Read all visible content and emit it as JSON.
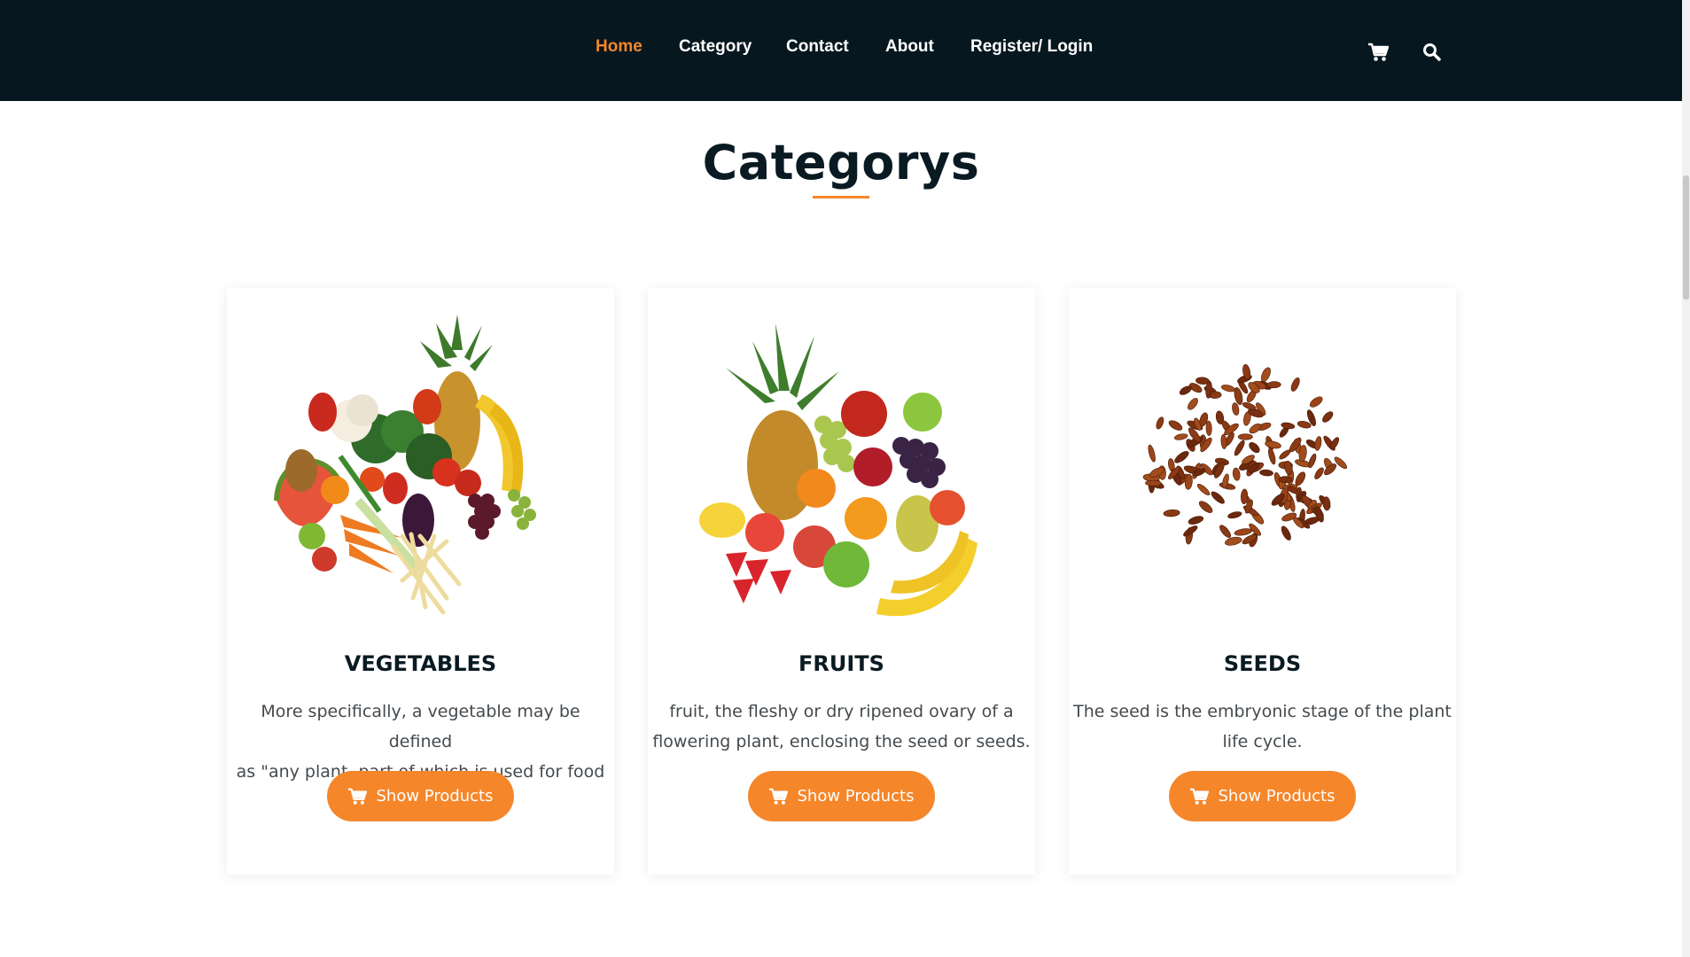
{
  "nav": {
    "links": [
      "Home",
      "Category",
      "Contact",
      "About",
      "Register/ Login"
    ],
    "active": "Home",
    "icons": [
      "cart-icon",
      "search-icon"
    ]
  },
  "section": {
    "title": "Categorys"
  },
  "categories": [
    {
      "title": "VEGETABLES",
      "desc_line1": "More specifically, a vegetable may be defined",
      "desc_line2": "as \"any plant, part of which is used for food",
      "button": "Show Products",
      "image": "vegetables-image"
    },
    {
      "title": "FRUITS",
      "desc_line1": "fruit, the fleshy or dry ripened ovary of a",
      "desc_line2": "flowering plant, enclosing the seed or seeds.",
      "button": "Show Products",
      "image": "fruits-image"
    },
    {
      "title": "SEEDS",
      "desc_line1": "The seed is the embryonic stage of the plant",
      "desc_line2": "life cycle.",
      "button": "Show Products",
      "image": "seeds-image"
    }
  ],
  "colors": {
    "navbar": "#07171f",
    "accent": "#f5862a",
    "heading": "#0a1a22",
    "text": "#444a4e"
  }
}
